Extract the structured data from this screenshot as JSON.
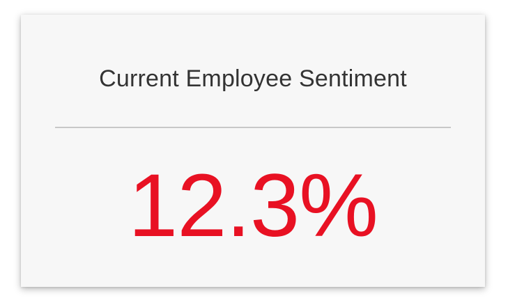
{
  "card": {
    "title": "Current Employee Sentiment",
    "value": "12.3%",
    "value_color": "#e81123"
  }
}
